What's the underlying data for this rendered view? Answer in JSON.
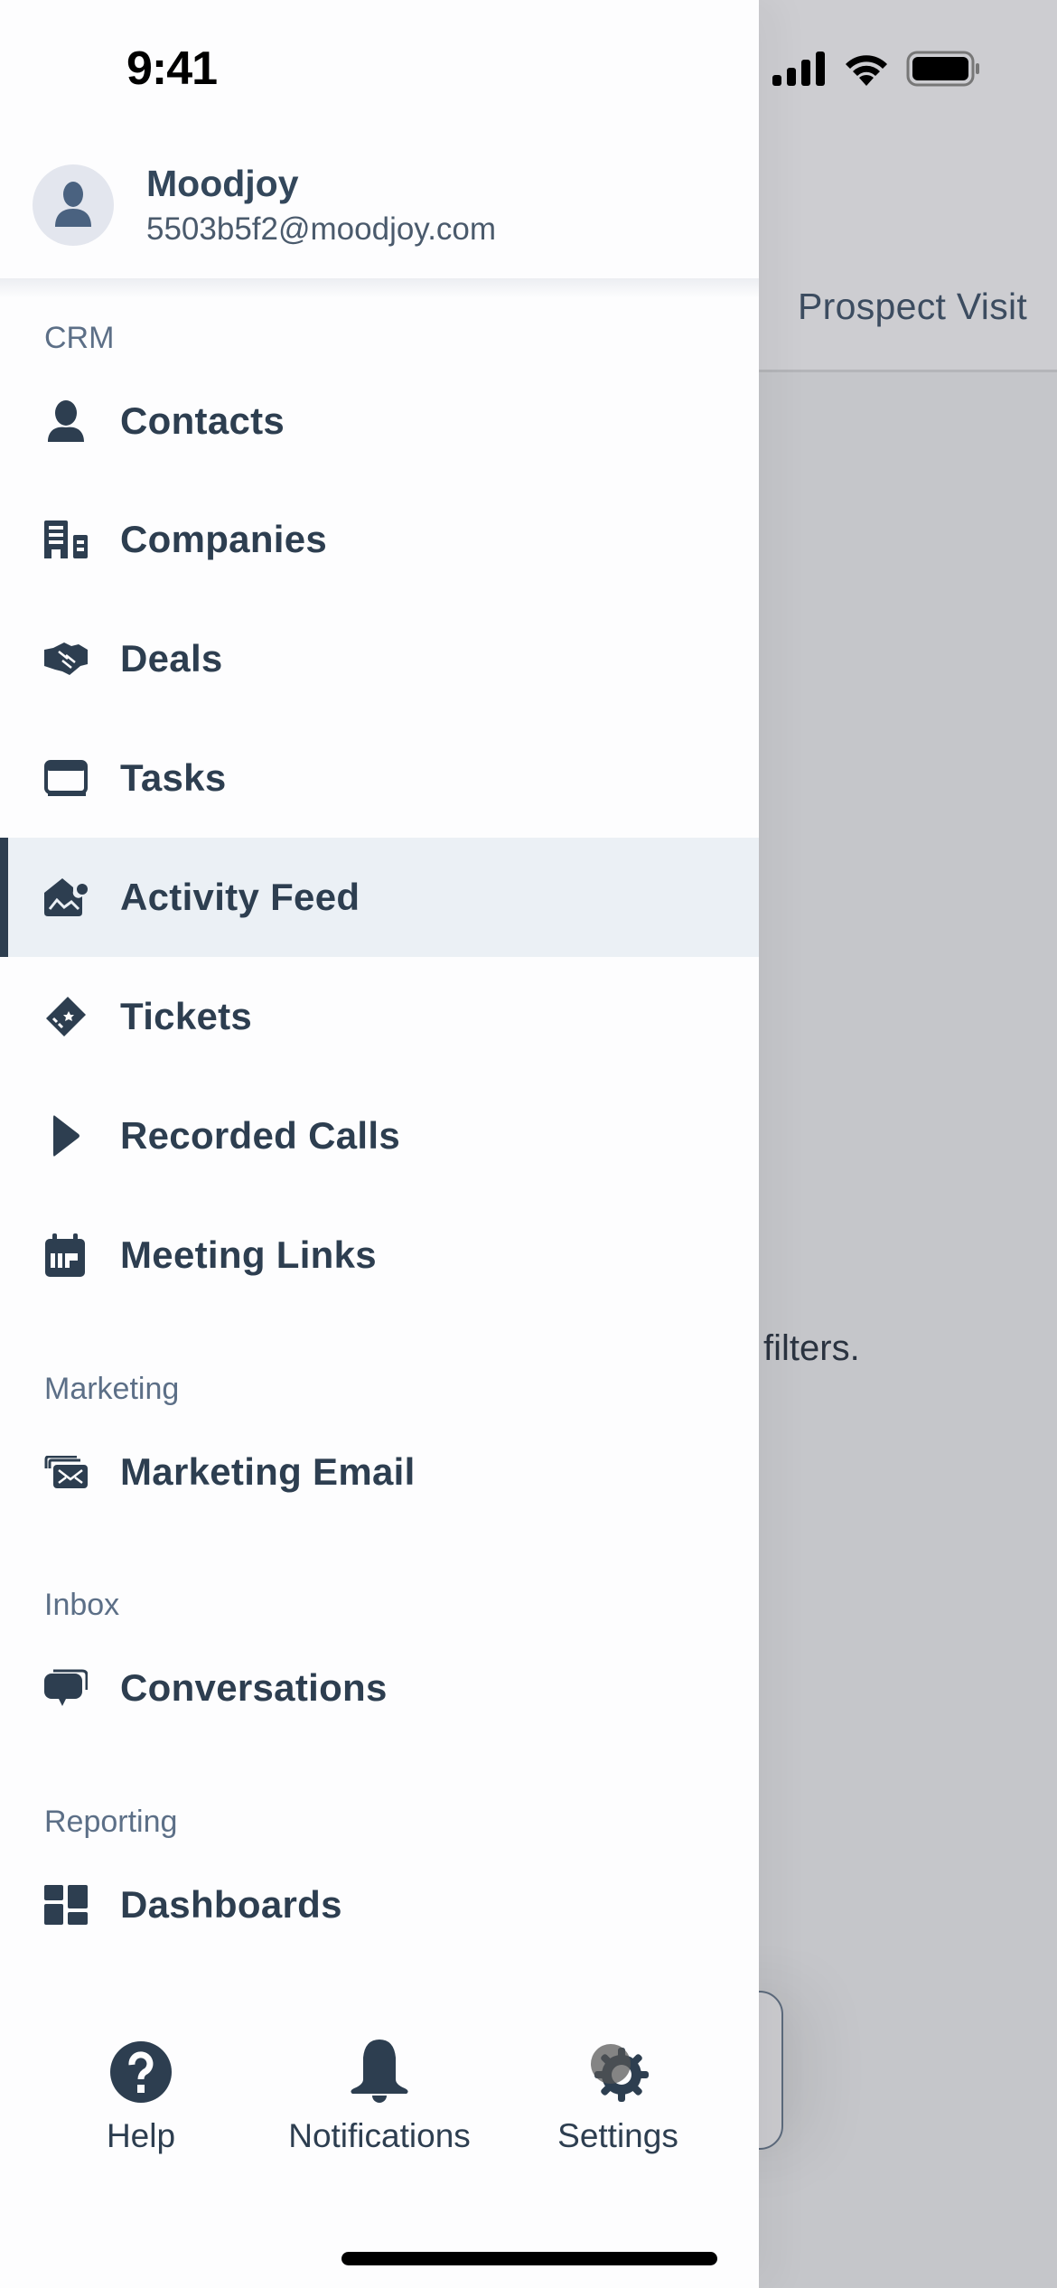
{
  "status_bar": {
    "time": "9:41",
    "icons": [
      "cellular-signal-icon",
      "wifi-icon",
      "battery-icon"
    ]
  },
  "background": {
    "tab_label": "Prospect Visit",
    "empty_state_text": "filters."
  },
  "drawer": {
    "profile": {
      "name": "Moodjoy",
      "email": "5503b5f2@moodjoy.com",
      "avatar_icon": "person-icon"
    },
    "sections": [
      {
        "label": "CRM",
        "items": [
          {
            "label": "Contacts",
            "icon": "contact-person-icon",
            "active": false
          },
          {
            "label": "Companies",
            "icon": "building-icon",
            "active": false
          },
          {
            "label": "Deals",
            "icon": "handshake-icon",
            "active": false
          },
          {
            "label": "Tasks",
            "icon": "tasks-icon",
            "active": false
          },
          {
            "label": "Activity Feed",
            "icon": "activity-feed-icon",
            "active": true
          },
          {
            "label": "Tickets",
            "icon": "ticket-icon",
            "active": false
          },
          {
            "label": "Recorded Calls",
            "icon": "play-icon",
            "active": false
          },
          {
            "label": "Meeting Links",
            "icon": "calendar-icon",
            "active": false
          }
        ]
      },
      {
        "label": "Marketing",
        "items": [
          {
            "label": "Marketing Email",
            "icon": "stacked-email-icon",
            "active": false
          }
        ]
      },
      {
        "label": "Inbox",
        "items": [
          {
            "label": "Conversations",
            "icon": "chat-bubbles-icon",
            "active": false
          }
        ]
      },
      {
        "label": "Reporting",
        "items": [
          {
            "label": "Dashboards",
            "icon": "dashboard-grid-icon",
            "active": false
          }
        ]
      }
    ],
    "bottom_bar": [
      {
        "label": "Help",
        "icon": "help-circle-icon"
      },
      {
        "label": "Notifications",
        "icon": "bell-icon"
      },
      {
        "label": "Settings",
        "icon": "gear-icon"
      }
    ]
  },
  "colors": {
    "primary_text": "#2d3e50",
    "section_label": "#5c6f87",
    "active_bg": "#ebf0f5",
    "scrim": "#c5c6ca"
  }
}
